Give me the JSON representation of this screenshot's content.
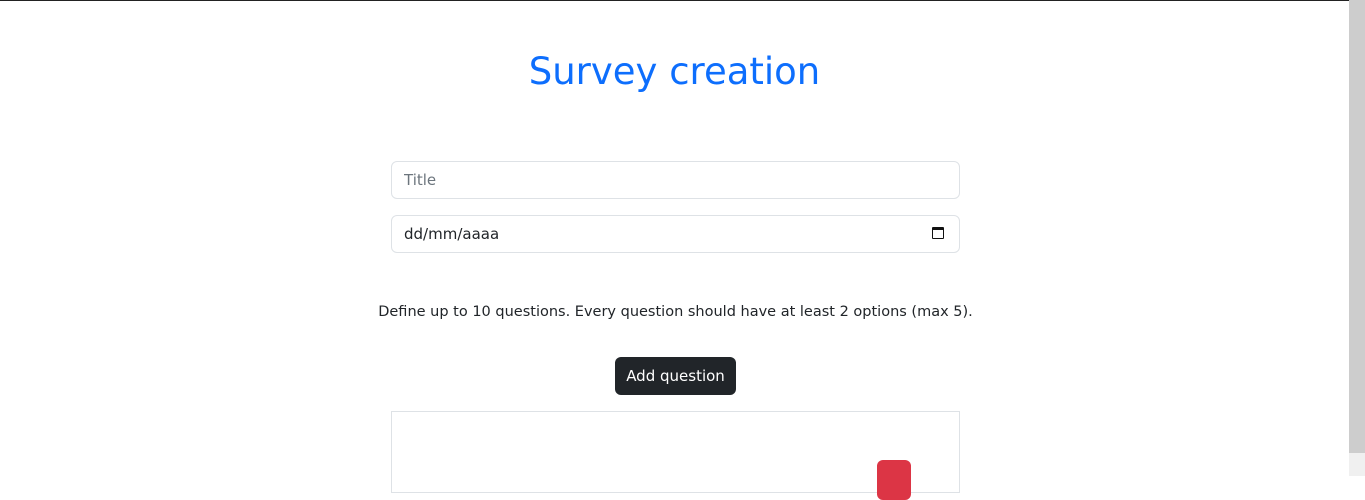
{
  "page": {
    "title": "Survey creation"
  },
  "form": {
    "title_placeholder": "Title",
    "date_placeholder": "dd/mm/aaaa",
    "info": "Define up to 10 questions. Every question should have at least 2 options (max 5).",
    "add_question_label": "Add question"
  },
  "colors": {
    "accent": "#0d6efd",
    "danger": "#dc3545",
    "dark": "#212529"
  }
}
